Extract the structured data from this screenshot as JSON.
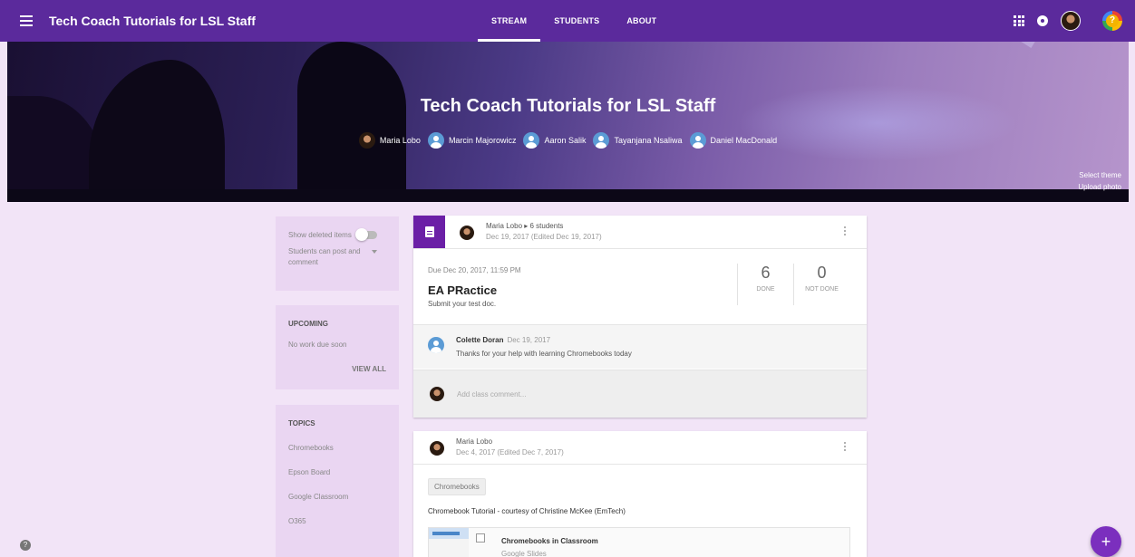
{
  "app": {
    "title": "Tech Coach Tutorials for LSL Staff"
  },
  "tabs": [
    {
      "label": "STREAM"
    },
    {
      "label": "STUDENTS"
    },
    {
      "label": "ABOUT"
    }
  ],
  "banner": {
    "title": "Tech Coach Tutorials for LSL Staff",
    "teachers": [
      "Maria Lobo",
      "Marcin Majorowicz",
      "Aaron Salik",
      "Tayanjana Nsaliwa",
      "Daniel MacDonald"
    ],
    "select_theme": "Select theme",
    "upload_photo": "Upload photo"
  },
  "sidebar": {
    "show_deleted": "Show deleted items",
    "post_setting": "Students can post and comment",
    "upcoming_heading": "UPCOMING",
    "upcoming_text": "No work due soon",
    "view_all": "VIEW ALL",
    "topics_heading": "TOPICS",
    "topics": [
      "Chromebooks",
      "Epson Board",
      "Google Classroom",
      "O365"
    ]
  },
  "assignment": {
    "author": "Maria Lobo",
    "audience": "6 students",
    "date": "Dec 19, 2017 (Edited Dec 19, 2017)",
    "due": "Due Dec 20, 2017, 11:59 PM",
    "title": "EA PRactice",
    "description": "Submit your test doc.",
    "done_count": "6",
    "done_label": "DONE",
    "not_done_count": "0",
    "not_done_label": "NOT DONE",
    "comment": {
      "author": "Colette Doran",
      "date": "Dec 19, 2017",
      "text": "Thanks for your help with learning Chromebooks today"
    },
    "add_comment_placeholder": "Add class comment..."
  },
  "post": {
    "author": "Maria Lobo",
    "date": "Dec 4, 2017 (Edited Dec 7, 2017)",
    "topic_chip": "Chromebooks",
    "text": "Chromebook Tutorial - courtesy of Christine McKee (EmTech)",
    "attachment_title": "Chromebooks in Classroom",
    "attachment_type": "Google Slides"
  },
  "fab_symbol": "+",
  "help_symbol": "?",
  "colors": {
    "topbar": "#5b2a9c",
    "background": "#f2e4f7",
    "accent": "#6b1fa6"
  }
}
